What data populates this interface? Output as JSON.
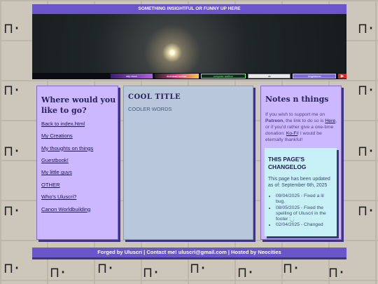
{
  "banner": {
    "text": "SOMETHING INSIGHTFUL OR FUNNY UP HERE"
  },
  "buttons": [
    "skip skool",
    "download number",
    "computer saelhun",
    "ok",
    "kingdokerst",
    "▶"
  ],
  "left": {
    "title": "Where would you like to go?",
    "links": [
      "Back to index.html",
      "My Creations",
      "My thoughts on things",
      "Guestbook!",
      "My little guys",
      "OTHER",
      "Who's Uluscri?",
      "Canon Worldbuilding"
    ]
  },
  "mid": {
    "title": "COOL TITLE",
    "subtitle": "COOLER WORDS"
  },
  "right": {
    "title": "Notes n things",
    "support_pre": "If you wish to support me on ",
    "patreon": "Patreon",
    "support_mid": ", the link to do so is ",
    "here": "Here",
    "support_mid2": ", or if you'd rather give a one-time donation: ",
    "kofi": "Ko-Fi",
    "support_end": "! I would be eternally thankful!"
  },
  "changelog": {
    "title": "THIS PAGE'S CHANGELOG",
    "updated": "This page has been updated as of: September 6th, 2025",
    "items": [
      "09/04/2025 - Fixed a lil bug.",
      "08/05/2025 - Fixed the spelling of Uluscri in the footer ;_;",
      "02/04/2025 - Changed"
    ]
  },
  "footer": {
    "text": "Forged by Uluscri | Contact me! uluscri@gmail.com | Hosted by Neocities"
  }
}
